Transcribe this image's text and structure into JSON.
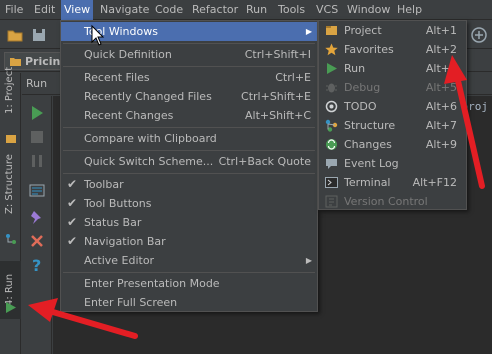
{
  "menubar": {
    "items": [
      "File",
      "Edit",
      "View",
      "Navigate",
      "Code",
      "Refactor",
      "Run",
      "Tools",
      "VCS",
      "Window",
      "Help"
    ]
  },
  "navbar": {
    "crumb": "Pricin"
  },
  "tool_stripe": {
    "project": "1: Project",
    "structure": "Z: Structure",
    "run": "4: Run"
  },
  "run_panel": {
    "title": "Run",
    "console_text": "proj"
  },
  "view_menu": {
    "items": [
      {
        "label": "Tool Windows",
        "shortcut": "",
        "has_submenu": true
      },
      {
        "label": "Quick Definition",
        "shortcut": "Ctrl+Shift+I"
      },
      {
        "label": "Recent Files",
        "shortcut": "Ctrl+E"
      },
      {
        "label": "Recently Changed Files",
        "shortcut": "Ctrl+Shift+E"
      },
      {
        "label": "Recent Changes",
        "shortcut": "Alt+Shift+C"
      },
      {
        "label": "Compare with Clipboard",
        "shortcut": ""
      },
      {
        "label": "Quick Switch Scheme...",
        "shortcut": "Ctrl+Back Quote"
      },
      {
        "label": "Toolbar",
        "checked": true
      },
      {
        "label": "Tool Buttons",
        "checked": true
      },
      {
        "label": "Status Bar",
        "checked": true
      },
      {
        "label": "Navigation Bar",
        "checked": true
      },
      {
        "label": "Active Editor",
        "shortcut": "",
        "has_submenu": true
      },
      {
        "label": "Enter Presentation Mode",
        "shortcut": ""
      },
      {
        "label": "Enter Full Screen",
        "shortcut": ""
      }
    ]
  },
  "tool_windows_menu": {
    "items": [
      {
        "label": "Project",
        "shortcut": "Alt+1",
        "icon": "project-icon"
      },
      {
        "label": "Favorites",
        "shortcut": "Alt+2",
        "icon": "star-icon"
      },
      {
        "label": "Run",
        "shortcut": "Alt+4",
        "icon": "run-icon"
      },
      {
        "label": "Debug",
        "shortcut": "Alt+5",
        "icon": "debug-icon",
        "disabled": true
      },
      {
        "label": "TODO",
        "shortcut": "Alt+6",
        "icon": "todo-icon"
      },
      {
        "label": "Structure",
        "shortcut": "Alt+7",
        "icon": "structure-icon"
      },
      {
        "label": "Changes",
        "shortcut": "Alt+9",
        "icon": "changes-icon"
      },
      {
        "label": "Event Log",
        "shortcut": "",
        "icon": "chat-icon"
      },
      {
        "label": "Terminal",
        "shortcut": "Alt+F12",
        "icon": "terminal-icon"
      },
      {
        "label": "Version Control",
        "shortcut": "",
        "icon": "vcs-icon",
        "disabled": true
      }
    ]
  },
  "colors": {
    "background": "#3c3f41",
    "selection": "#4b6eaf",
    "annotation_arrow": "#e31e24",
    "run_green": "#499c54"
  }
}
